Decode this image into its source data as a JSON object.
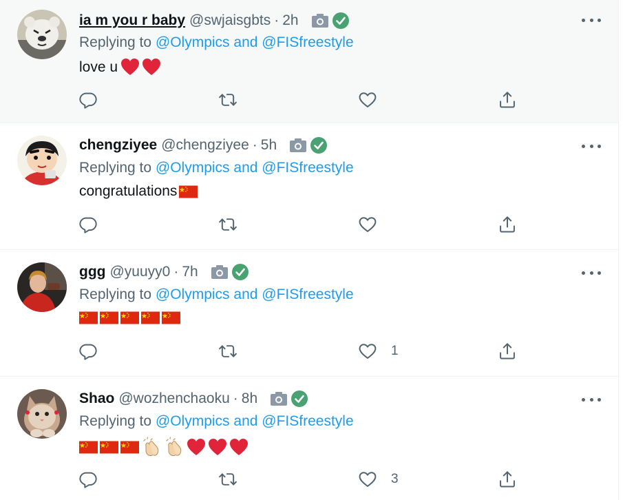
{
  "colors": {
    "name": "#0f1419",
    "secondary": "#536471",
    "link": "#1d9bf0",
    "verified": "#4aa172",
    "heart": "#e0243a",
    "flag": "#de2910",
    "flag_star": "#ffde00"
  },
  "tweets": [
    {
      "name": "ia m you r baby",
      "handle": "@swjaisgbts",
      "dot": "·",
      "time": "2h",
      "reply_prefix": "Replying to",
      "reply_mentions": "@Olympics and @FISfreestyle",
      "text": "love u",
      "emojis": [
        "red-heart",
        "red-heart"
      ],
      "like_count": "",
      "avatar": "white-plush-bear"
    },
    {
      "name": "chengziyee",
      "handle": "@chengziyee",
      "dot": "·",
      "time": "5h",
      "reply_prefix": "Replying to",
      "reply_mentions": "@Olympics and @FISfreestyle",
      "text": "congratulations",
      "emojis": [
        "china-flag"
      ],
      "like_count": "",
      "avatar": "cartoon-boy"
    },
    {
      "name": "ggg",
      "handle": "@yuuyy0",
      "dot": "·",
      "time": "7h",
      "reply_prefix": "Replying to",
      "reply_mentions": "@Olympics and @FISfreestyle",
      "text": "",
      "emojis": [
        "china-flag",
        "china-flag",
        "china-flag",
        "china-flag",
        "china-flag"
      ],
      "like_count": "1",
      "avatar": "person-red-jacket"
    },
    {
      "name": "Shao",
      "handle": "@wozhenchaoku",
      "dot": "·",
      "time": "8h",
      "reply_prefix": "Replying to",
      "reply_mentions": "@Olympics and @FISfreestyle",
      "text": "",
      "emojis": [
        "china-flag",
        "china-flag",
        "china-flag",
        "clapping-hands",
        "clapping-hands",
        "red-heart",
        "red-heart",
        "red-heart"
      ],
      "like_count": "3",
      "avatar": "cat"
    }
  ],
  "icons": {
    "camera": "camera-icon",
    "verified": "verified-badge-icon",
    "more": "more-options-icon",
    "reply": "reply-icon",
    "retweet": "retweet-icon",
    "like": "like-icon",
    "share": "share-icon"
  }
}
